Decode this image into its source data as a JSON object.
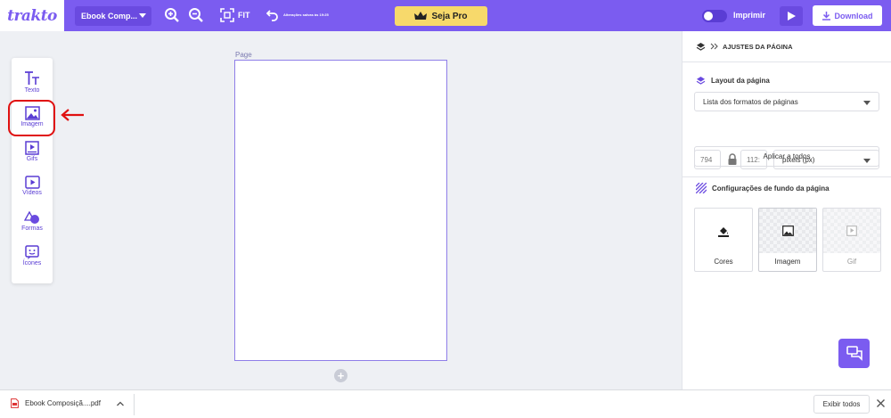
{
  "topbar": {
    "logo": "trakto",
    "doc_name": "Ebook Comp...",
    "fit_label": "FIT",
    "undo_note": "Alterações salvas às 19:25",
    "pro_label": "Seja Pro",
    "print_label": "Imprimir",
    "download_label": "Download"
  },
  "tools": [
    {
      "label": "Texto",
      "icon": "text-icon"
    },
    {
      "label": "Imagem",
      "icon": "image-icon"
    },
    {
      "label": "Gifs",
      "icon": "gif-icon"
    },
    {
      "label": "Vídeos",
      "icon": "video-icon"
    },
    {
      "label": "Formas",
      "icon": "shapes-icon"
    },
    {
      "label": "Ícones",
      "icon": "icons-icon"
    }
  ],
  "canvas": {
    "page_label": "Page",
    "add_symbol": "+"
  },
  "panel": {
    "header_title": "AJUSTES DA PÁGINA",
    "layout_title": "Layout da página",
    "format_select": "Lista dos formatos de páginas",
    "width_value": "794",
    "height_value": "112:",
    "unit_select": "pixels (px)",
    "apply_label": "Aplicar a todos",
    "bg_title": "Configurações de fundo da página",
    "bg_options": [
      {
        "label": "Cores"
      },
      {
        "label": "Imagem"
      },
      {
        "label": "Gif"
      }
    ]
  },
  "downloads": {
    "file_name": "Ebook Composiçã....pdf",
    "show_all": "Exibir todos"
  },
  "colors": {
    "brand": "#7b5cf0",
    "pro": "#f7d96b",
    "highlight": "#e01010"
  }
}
